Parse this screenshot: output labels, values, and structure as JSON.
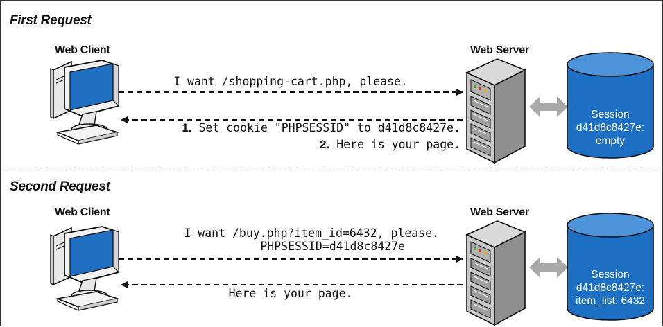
{
  "sections": [
    {
      "title": "First Request",
      "client_label": "Web Client",
      "server_label": "Web Server",
      "request_line": "I want /shopping-cart.php, please.",
      "response_items": [
        {
          "num": "1.",
          "text": "Set cookie \"PHPSESSID\" to d41d8c8427e."
        },
        {
          "num": "2.",
          "text": "Here is your page."
        }
      ],
      "session": {
        "line1": "Session",
        "line2": "d41d8c8427e:",
        "line3": "empty"
      }
    },
    {
      "title": "Second Request",
      "client_label": "Web Client",
      "server_label": "Web Server",
      "request_line1": "I want /buy.php?item_id=6432, please.",
      "request_line2": "PHPSESSID=d41d8c8427e",
      "response_line": "Here is your page.",
      "session": {
        "line1": "Session",
        "line2": "d41d8c8427e:",
        "line3": "item_list: 6432"
      }
    }
  ],
  "colors": {
    "monitor_screen": "#1f6fc2",
    "database_fill": "#1c6fc2",
    "database_top": "#4d93d9",
    "sync_arrow": "#a9a9a9",
    "server_body": "#b3b3b3",
    "divider": "#b5b5b5"
  },
  "icons": [
    "computer-icon",
    "server-icon",
    "database-icon",
    "bidirectional-arrow-icon"
  ]
}
